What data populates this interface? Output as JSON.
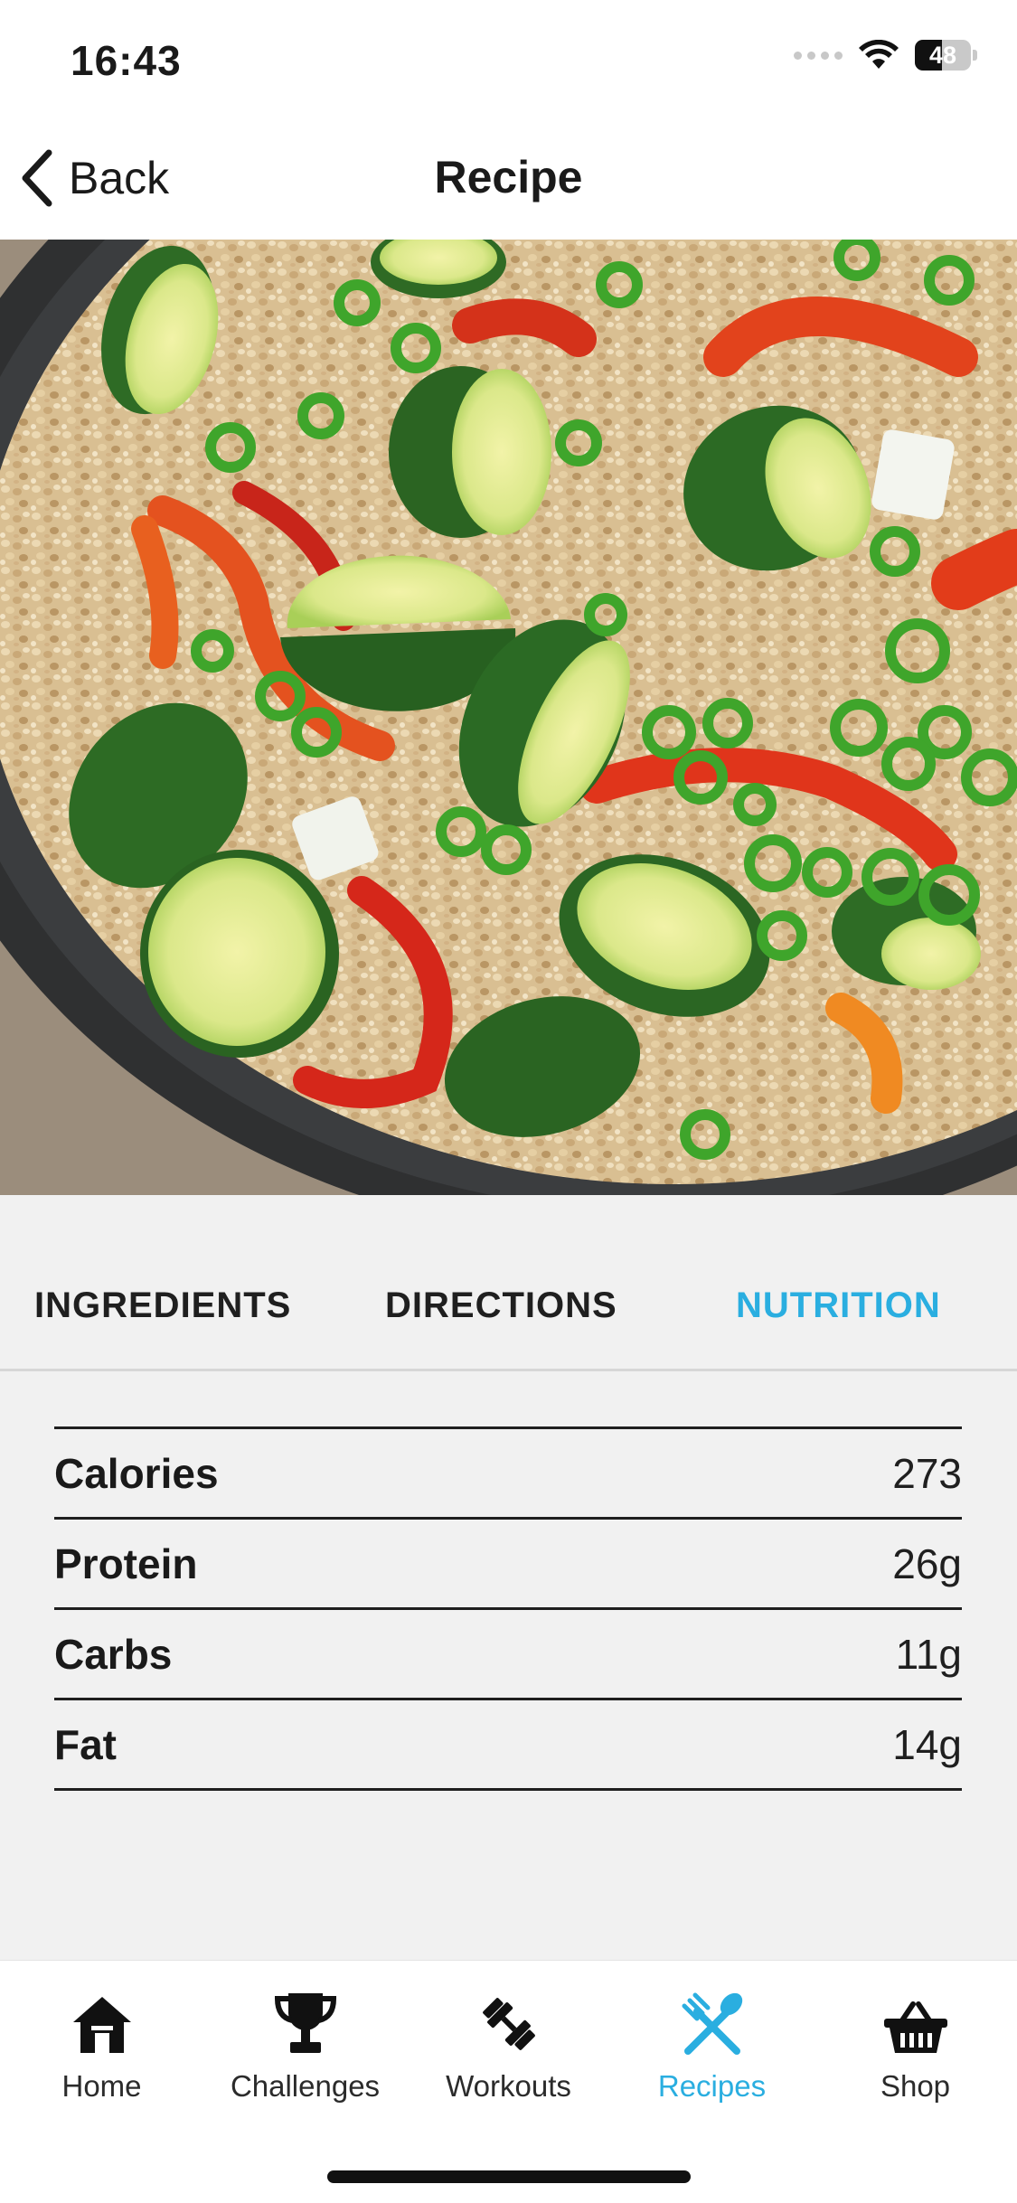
{
  "status_bar": {
    "time": "16:43",
    "battery": "48",
    "battery_level": 0.48
  },
  "header": {
    "back_label": "Back",
    "title": "Recipe"
  },
  "tabs": [
    {
      "label": "INGREDIENTS",
      "active": false
    },
    {
      "label": "DIRECTIONS",
      "active": false
    },
    {
      "label": "NUTRITION",
      "active": true
    }
  ],
  "nutrition": [
    {
      "label": "Calories",
      "value": "273"
    },
    {
      "label": "Protein",
      "value": "26g"
    },
    {
      "label": "Carbs",
      "value": "11g"
    },
    {
      "label": "Fat",
      "value": "14g"
    }
  ],
  "tab_bar": [
    {
      "label": "Home",
      "icon": "home-icon",
      "active": false
    },
    {
      "label": "Challenges",
      "icon": "trophy-icon",
      "active": false
    },
    {
      "label": "Workouts",
      "icon": "dumbbell-icon",
      "active": false
    },
    {
      "label": "Recipes",
      "icon": "fork-spoon-icon",
      "active": true
    },
    {
      "label": "Shop",
      "icon": "basket-icon",
      "active": false
    }
  ],
  "colors": {
    "accent": "#2aaee0",
    "text": "#1a1a1a",
    "background": "#f1f1f1"
  }
}
